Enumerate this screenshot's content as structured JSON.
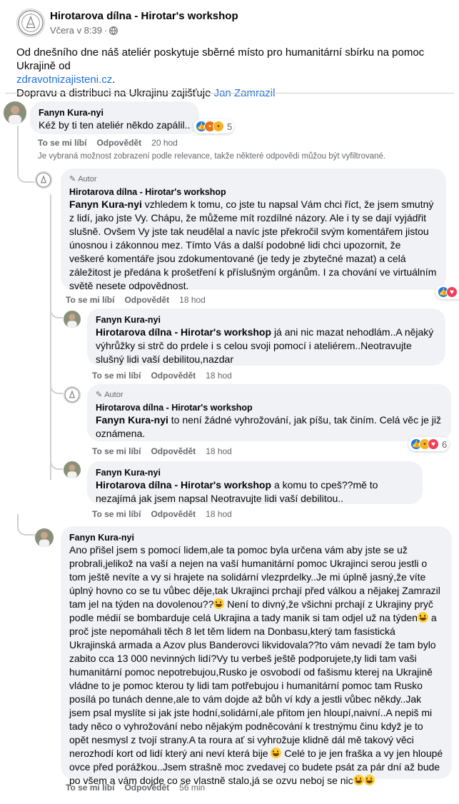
{
  "post": {
    "page_name": "Hirotarova dílna - Hirotar's workshop",
    "time": "Včera v 8:39",
    "separator": "·",
    "text_line1": "Od dnešního dne náš ateliér poskytuje sběrné místo pro humanitární sbírku na pomoc Ukrajině od",
    "link1": "zdravotnizajisteni.cz",
    "link1_suffix": ".",
    "text_line3": "Dopravu a distribuci na Ukrajinu zajišťuje",
    "link2": "Jan Zamrazil"
  },
  "labels": {
    "like": "To se mi líbí",
    "reply": "Odpovědět",
    "author_badge": "Autor"
  },
  "filter_note": "Je vybraná možnost zobrazení podle relevance, takže některé odpovědi můžou být vyfiltrované.",
  "comments": [
    {
      "author": "Fanyn Kura-nyi",
      "text": "Kéž by ti ten ateliér někdo zapálil..",
      "time": "20 hod",
      "reactions": [
        "like",
        "angry",
        "haha"
      ],
      "reaction_count": "5"
    },
    {
      "author": "Hirotarova dílna - Hirotar's workshop",
      "mention": "Fanyn Kura-nyi",
      "text": "vzhledem k tomu, co jste tu napsal Vám chci říct, že jsem smutný z lidí, jako jste Vy. Chápu, že můžeme mít rozdílné názory. Ale i ty se dají vyjádřit slušně. Ovšem Vy jste tak neudělal a navíc jste překročil svým komentářem jistou únosnou i zákonnou mez. Tímto Vás a další podobné lidi chci upozornit, že veškeré komentáře jsou zdokumentované (je tedy je zbytečné mazat) a celá záležitost je předána k prošetření k příslušným orgánům. I za chování ve virtuálním světě nesete odpovědnost.",
      "time": "18 hod",
      "reactions": [
        "like",
        "love"
      ],
      "reaction_count": "9"
    },
    {
      "author": "Fanyn Kura-nyi",
      "mention": "Hirotarova dílna - Hirotar's workshop",
      "text": "já ani nic mazat nehodlám..A nějaký výhrůžky si strč do prdele i s celou svoji pomocí i ateliérem..Neotravujte slušný lidi vaší debilitou,nazdar",
      "time": "18 hod"
    },
    {
      "author": "Hirotarova dílna - Hirotar's workshop",
      "mention": "Fanyn Kura-nyi",
      "text": "to není žádné vyhrožování, jak píšu, tak činím. Celá věc je již oznámena.",
      "time": "18 hod",
      "reactions": [
        "like",
        "haha",
        "love"
      ],
      "reaction_count": "6"
    },
    {
      "author": "Fanyn Kura-nyi",
      "mention": "Hirotarova dílna - Hirotar's workshop",
      "text": "a komu to cpeš??mě to nezajímá jak jsem napsal Neotravujte lidi vaší debilitou..",
      "time": "18 hod"
    },
    {
      "author": "Fanyn Kura-nyi",
      "text_parts": [
        "Ano přišel jsem s pomocí lidem,ale ta pomoc byla určena vám aby jste se už probrali,jelikož na vaší a nejen na vaší humanitární pomoc Ukrajinci serou jestli o tom ještě nevíte a vy si hrajete na solidární vlezprdelky..Je mi úplně jasný,že víte úplný hovno co se tu vůbec děje,tak Ukrajinci prchají před válkou a nějakej Zamrazil tam jel na týden na dovolenou??",
        " Není to divný,že všichni prchají z Ukrajiny pryč podle médií se bombarduje celá Ukrajina a tady manik si tam odjel už na týden",
        " a proč jste nepomáhali těch 8 let těm lidem na Donbasu,který tam fasistická Ukrajinská armada a Azov plus Banderovci likvidovala??to vám nevadí že tam bylo zabito cca 13 000 nevinných lidí?Vy tu verbeš ještě podporujete,ty lidi tam vaši humanitární pomoc nepotrebujou,Rusko je osvobodí od fašismu kterej na Ukrajině vládne to je pomoc kterou ty lidi tam potřebujou i humanitární pomoc tam Rusko posílá po tunách denne,ale to vám dojde až bůh ví kdy a jestli vůbec někdy..Jak jsem psal myslíte si jak jste hodní,solidární,ale přitom jen hloupí,naivní..A nepiš mi tady něco o vyhrožování nebo nějakým podněcování k trestnýmu činu když je to opět nesmysl z tvojí strany.A ta roura ať si vyhrožuje klidně dál mě takový věci nerozhodí kort od lidí který ani neví která bije",
        " Celé to je jen fraška a vy jen hloupé ovce před porážkou..Jsem strašně moc zvedavej co budete psát za pár dní až bude po všem a vám dojde co se vlastně stalo,já se ozvu neboj se nic"
      ],
      "time": "56 min"
    }
  ]
}
